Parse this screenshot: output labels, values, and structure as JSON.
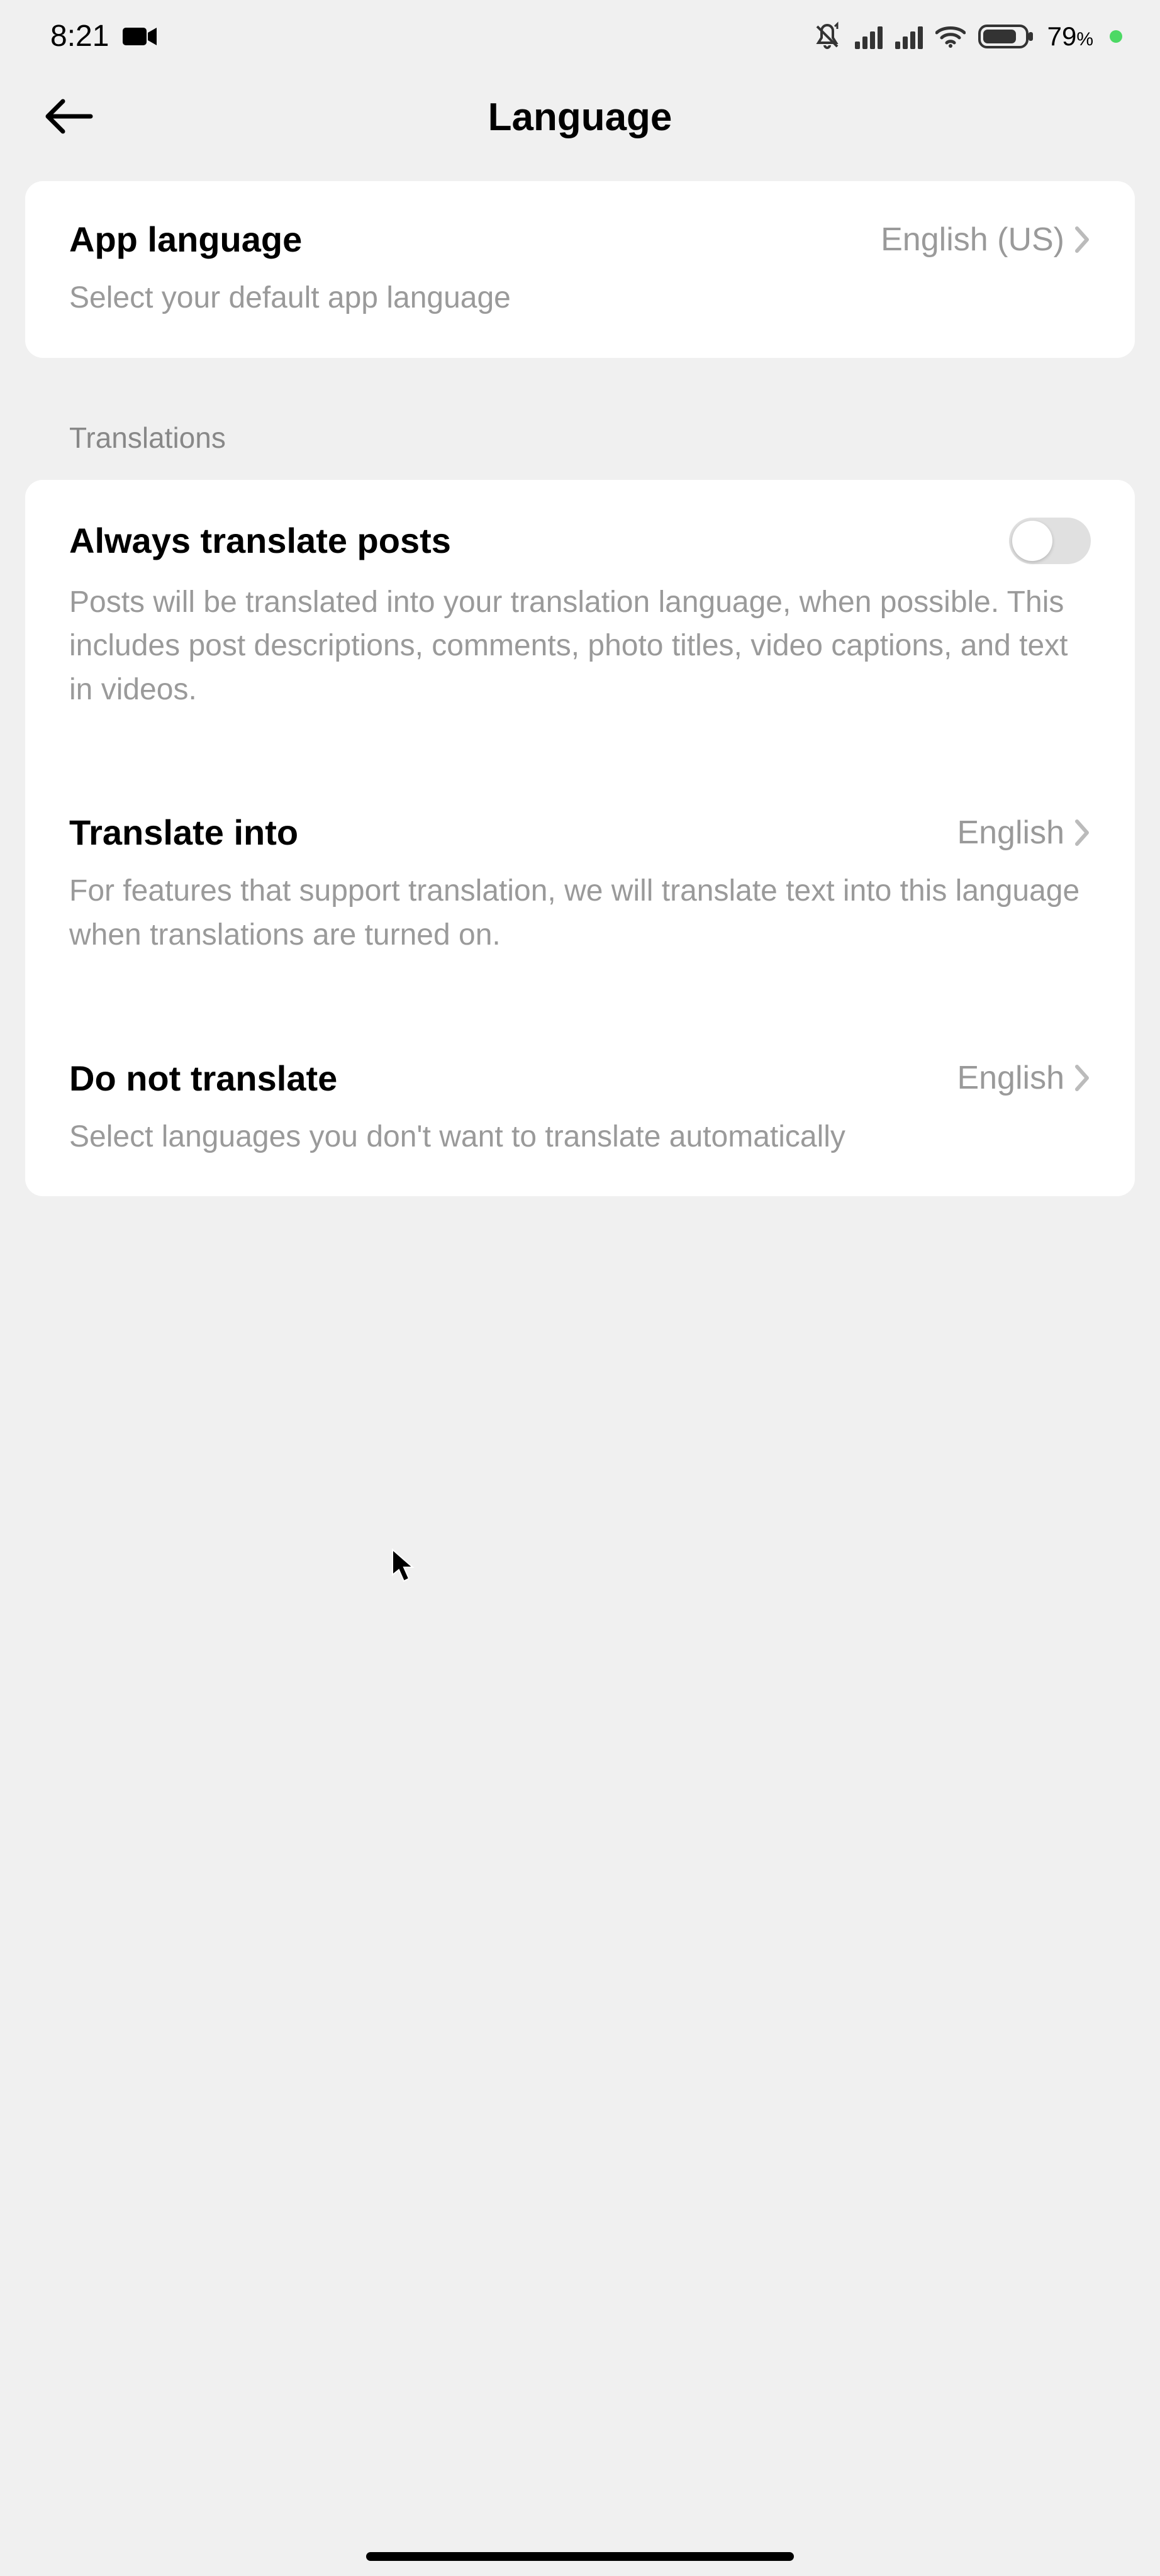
{
  "status": {
    "time": "8:21",
    "battery": "79",
    "battery_suffix": "%"
  },
  "header": {
    "title": "Language"
  },
  "section1": {
    "app_language": {
      "title": "App language",
      "value": "English (US)",
      "desc": "Select your default app language"
    }
  },
  "translations_header": "Translations",
  "section2": {
    "always_translate": {
      "title": "Always translate posts",
      "desc": "Posts will be translated into your translation language, when possible. This includes post descriptions, comments, photo titles, video captions, and text in videos."
    },
    "translate_into": {
      "title": "Translate into",
      "value": "English",
      "desc": "For features that support translation, we will translate text into this language when translations are turned on."
    },
    "do_not_translate": {
      "title": "Do not translate",
      "value": "English",
      "desc": "Select languages you don't want to translate automatically"
    }
  }
}
